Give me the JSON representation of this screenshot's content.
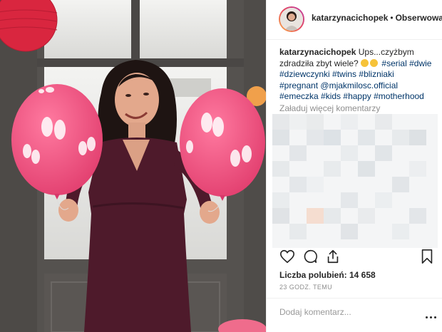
{
  "header": {
    "username": "katarzynacichopek",
    "separator": "•",
    "follow_label": "Obserwowanie"
  },
  "caption": {
    "username": "katarzynacichopek",
    "text_part1": "Ups...czyżbym zdradziła zbyt wiele?",
    "hashtags_line1": [
      "#serial",
      "#dwie"
    ],
    "hashtags_line2": [
      "#dziewczynki",
      "#twins",
      "#blizniaki",
      "#pregnant"
    ],
    "mention": "@mjakmilosc.official",
    "hashtags_line3": [
      "#emeczka",
      "#kids"
    ],
    "hashtags_line4": [
      "#happy",
      "#motherhood"
    ]
  },
  "load_more_label": "Załaduj więcej komentarzy",
  "likes_text": "Liczba polubień: 14 658",
  "timestamp": "23 GODZ. TEMU",
  "comment_placeholder": "Dodaj komentarz...",
  "colors": {
    "hashtag": "#003569",
    "balloon": "#ef4f7e",
    "dress": "#4e1a2b"
  },
  "icons": [
    "heart-icon",
    "comment-icon",
    "share-icon",
    "bookmark-icon",
    "more-options-icon"
  ]
}
